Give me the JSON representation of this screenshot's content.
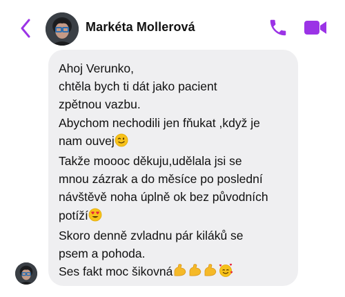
{
  "header": {
    "contact_name": "Markéta Mollerová",
    "back_icon": "chevron-left-icon",
    "call_icon": "phone-icon",
    "video_icon": "video-camera-icon",
    "accent_color": "#9b33e6"
  },
  "message": {
    "lines": [
      "Ahoj Verunko,",
      "chtěla bych ti dát jako pacient",
      "zpětnou vazbu.",
      "Abychom nechodili jen fňukat ,když je",
      "nam ouvej",
      "Takže moooc děkuju,udělala jsi se",
      "mnou zázrak a do měsíce po poslední",
      "návštěvě noha úplně ok bez původních",
      "potíží",
      "Skoro denně zvladnu pár kiláků se",
      "psem a pohoda.",
      "Ses fakt moc šikovná"
    ],
    "emojis": {
      "line_4": "winking-face",
      "line_8": "heart-eyes-face",
      "line_11": [
        "flexed-biceps",
        "flexed-biceps",
        "flexed-biceps",
        "smiling-face-with-hearts"
      ]
    },
    "bubble_color": "#efeff1"
  }
}
